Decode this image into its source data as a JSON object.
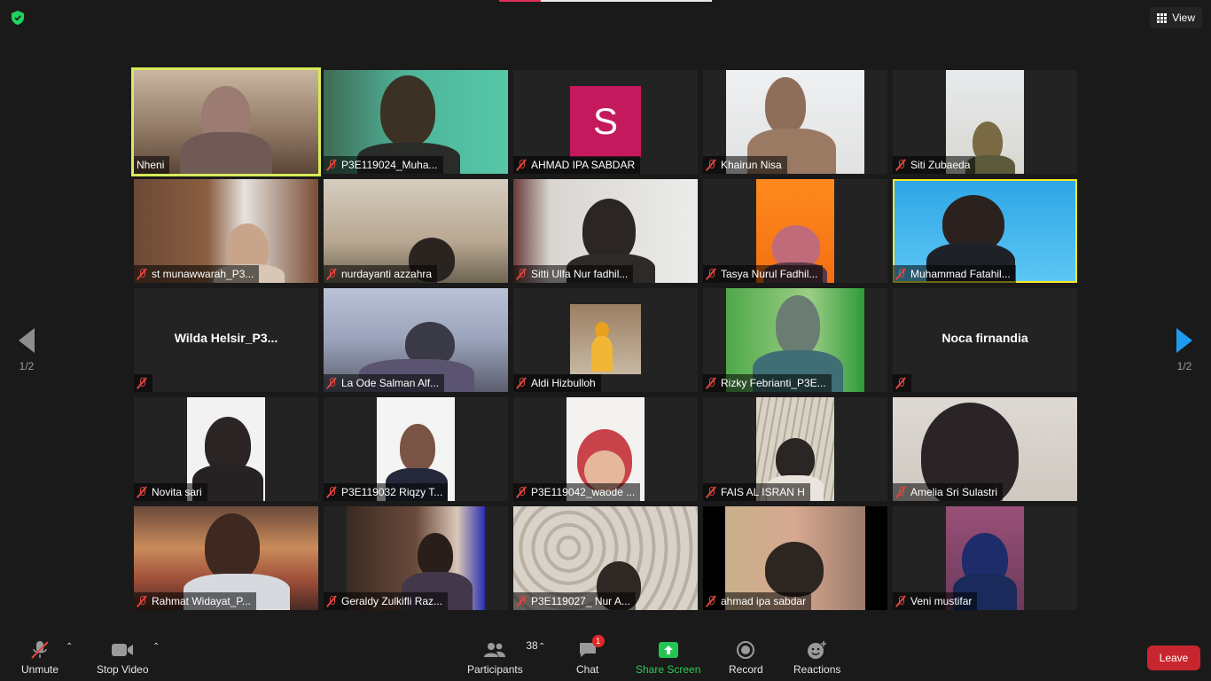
{
  "window": {
    "view_label": "View",
    "page_indicator_left": "1/2",
    "page_indicator_right": "1/2"
  },
  "colors": {
    "active_speaker_border": "#d8eb5a",
    "muted_icon": "#e0463f",
    "avatar_bg": "#c4195d",
    "leave_bg": "#c8262e",
    "share_screen": "#2ecc5a"
  },
  "participants": [
    {
      "name": "Nheni",
      "muted": false,
      "active": true
    },
    {
      "name": "P3E119024_Muha...",
      "muted": true
    },
    {
      "name": "AHMAD IPA SABDAR",
      "muted": true,
      "avatar_letter": "S"
    },
    {
      "name": "Khairun Nisa",
      "muted": true
    },
    {
      "name": "Siti Zubaeda",
      "muted": true
    },
    {
      "name": "st munawwarah_P3...",
      "muted": true
    },
    {
      "name": "nurdayanti azzahra",
      "muted": true
    },
    {
      "name": "Sitti Ulfa Nur fadhil...",
      "muted": true
    },
    {
      "name": "Tasya Nurul Fadhil...",
      "muted": true
    },
    {
      "name": "Muhammad Fatahil...",
      "muted": true
    },
    {
      "name": "Wilda  Helsir_P3...",
      "muted": true,
      "video_off": true
    },
    {
      "name": "La Ode Salman Alf...",
      "muted": true
    },
    {
      "name": "Aldi Hizbulloh",
      "muted": true
    },
    {
      "name": "Rizky Febrianti_P3E...",
      "muted": true
    },
    {
      "name": "Noca firnandia",
      "muted": true,
      "video_off": true
    },
    {
      "name": "Novita sari",
      "muted": true
    },
    {
      "name": "P3E119032 Riqzy T...",
      "muted": true
    },
    {
      "name": "P3E119042_waode ...",
      "muted": true
    },
    {
      "name": "FAIS AL ISRAN H",
      "muted": true
    },
    {
      "name": "Amelia Sri Sulastri",
      "muted": true
    },
    {
      "name": "Rahmat Widayat_P...",
      "muted": true
    },
    {
      "name": "Geraldy Zulkifli Raz...",
      "muted": true
    },
    {
      "name": "P3E119027_ Nur A...",
      "muted": true
    },
    {
      "name": "ahmad ipa sabdar",
      "muted": true
    },
    {
      "name": "Veni mustifar",
      "muted": true
    }
  ],
  "toolbar": {
    "unmute": "Unmute",
    "stop_video": "Stop Video",
    "participants": "Participants",
    "participants_count": "38",
    "chat": "Chat",
    "chat_badge": "1",
    "share_screen": "Share Screen",
    "record": "Record",
    "reactions": "Reactions",
    "leave": "Leave"
  }
}
